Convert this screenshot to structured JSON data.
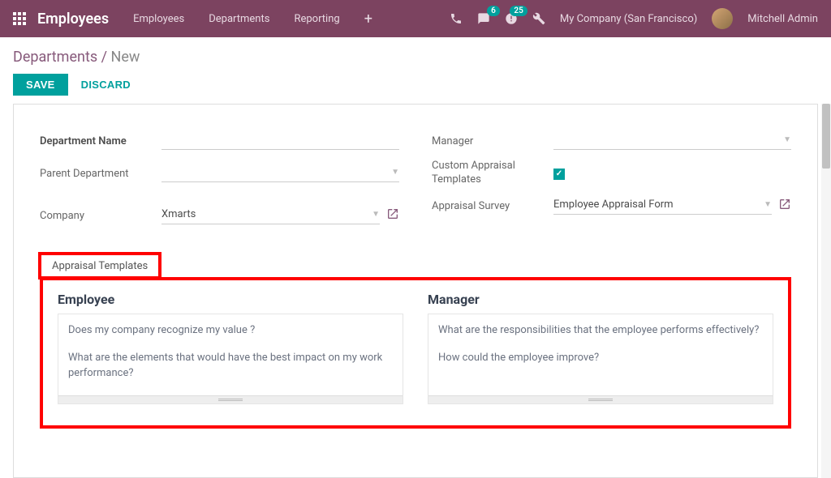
{
  "header": {
    "brand": "Employees",
    "nav": [
      "Employees",
      "Departments",
      "Reporting"
    ],
    "badges": {
      "messages": "6",
      "activities": "25"
    },
    "company": "My Company (San Francisco)",
    "user": "Mitchell Admin"
  },
  "breadcrumb": {
    "root": "Departments",
    "current": "New"
  },
  "buttons": {
    "save": "SAVE",
    "discard": "DISCARD"
  },
  "form": {
    "left": {
      "dept_name_label": "Department Name",
      "dept_name_value": "",
      "parent_label": "Parent Department",
      "parent_value": "",
      "company_label": "Company",
      "company_value": "Xmarts"
    },
    "right": {
      "manager_label": "Manager",
      "manager_value": "",
      "custom_tpl_label": "Custom Appraisal Templates",
      "custom_tpl_checked": true,
      "survey_label": "Appraisal Survey",
      "survey_value": "Employee Appraisal Form"
    }
  },
  "tab": {
    "label": "Appraisal Templates"
  },
  "templates": {
    "employee": {
      "title": "Employee",
      "q1": "Does my company recognize my value ?",
      "q2": "What are the elements that would have the best impact on my work performance?"
    },
    "manager": {
      "title": "Manager",
      "q1": "What are the responsibilities that the employee performs effectively?",
      "q2": "How could the employee improve?"
    }
  }
}
